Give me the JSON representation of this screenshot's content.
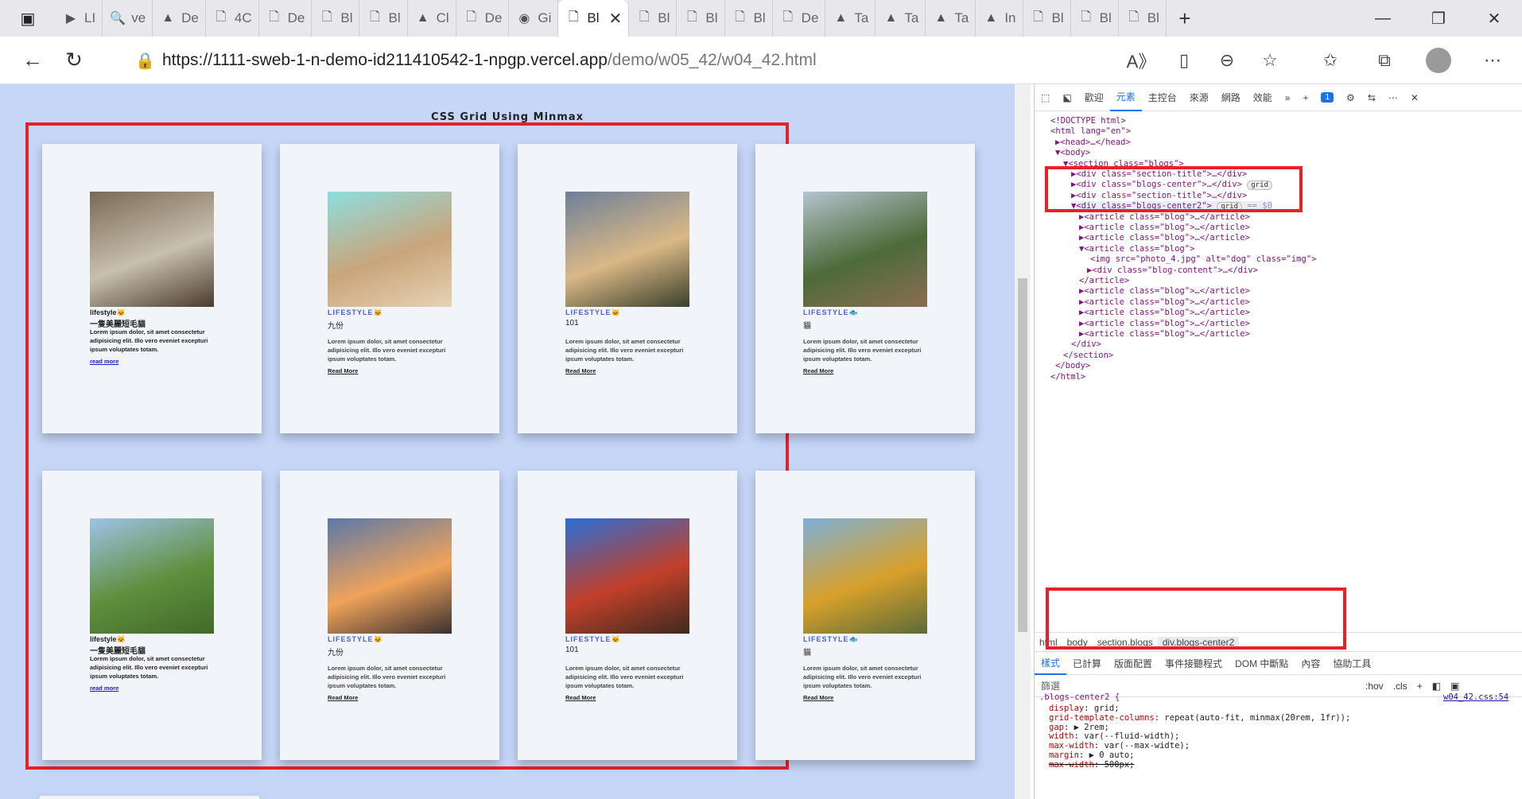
{
  "browser": {
    "tabs": [
      {
        "label": "LI",
        "icon": "play-icon"
      },
      {
        "label": "ve",
        "icon": "search-icon"
      },
      {
        "label": "De",
        "icon": "vercel-icon"
      },
      {
        "label": "4C",
        "icon": "document-icon"
      },
      {
        "label": "De",
        "icon": "document-icon"
      },
      {
        "label": "Bl",
        "icon": "document-icon"
      },
      {
        "label": "Bl",
        "icon": "document-icon"
      },
      {
        "label": "Cl",
        "icon": "vercel-icon"
      },
      {
        "label": "De",
        "icon": "document-icon"
      },
      {
        "label": "Gi",
        "icon": "github-icon"
      },
      {
        "label": "Bl",
        "icon": "document-icon",
        "active": true
      },
      {
        "label": "Bl",
        "icon": "document-icon"
      },
      {
        "label": "Bl",
        "icon": "document-icon"
      },
      {
        "label": "Bl",
        "icon": "document-icon"
      },
      {
        "label": "De",
        "icon": "document-icon"
      },
      {
        "label": "Ta",
        "icon": "vercel-icon"
      },
      {
        "label": "Ta",
        "icon": "vercel-icon"
      },
      {
        "label": "Ta",
        "icon": "vercel-icon"
      },
      {
        "label": "In",
        "icon": "vercel-icon"
      },
      {
        "label": "Bl",
        "icon": "document-icon"
      },
      {
        "label": "Bl",
        "icon": "document-icon"
      },
      {
        "label": "Bl",
        "icon": "document-icon"
      }
    ],
    "url_host": "https://1111-sweb-1-n-demo-id211410542-1-npgp.vercel.app",
    "url_path": "/demo/w05_42/w04_42.html"
  },
  "page": {
    "title": "CSS Grid Using Minmax",
    "blogs": [
      {
        "category": "lifestyle🐱",
        "title": "一隻美麗短毛貓",
        "text": "Lorem ipsum dolor, sit amet consectetur adipisicing elit. Illo vero eveniet excepturi ipsum voluptates totam.",
        "more": "read more",
        "image_colors": [
          "#7a6a55",
          "#c8bfae",
          "#4a3c2e"
        ]
      },
      {
        "category": "LIFESTYLE🐱",
        "title": "九份",
        "text": "Lorem ipsum dolor, sit amet consectetur adipisicing elit. Illo vero eveniet excepturi ipsum voluptates totam.",
        "more": "Read More",
        "image_colors": [
          "#8fdde0",
          "#c9a57a",
          "#e6d2b5"
        ]
      },
      {
        "category": "LIFESTYLE🐱",
        "title": "101",
        "text": "Lorem ipsum dolor, sit amet consectetur adipisicing elit. Illo vero eveniet excepturi ipsum voluptates totam.",
        "more": "Read More",
        "image_colors": [
          "#6e7f99",
          "#d9b886",
          "#3a3f2c"
        ]
      },
      {
        "category": "LIFESTYLE🐟",
        "title": "貓",
        "text": "Lorem ipsum dolor, sit amet consectetur adipisicing elit. Illo vero eveniet excepturi ipsum voluptates totam.",
        "more": "Read More",
        "image_colors": [
          "#b5c3cf",
          "#4d6b3a",
          "#8a6d52"
        ]
      },
      {
        "category": "lifestyle🐱",
        "title": "一隻美麗短毛貓",
        "text": "Lorem ipsum dolor, sit amet consectetur adipisicing elit. Illo vero eveniet excepturi ipsum voluptates totam.",
        "more": "read more",
        "image_colors": [
          "#9ec3e8",
          "#5f8f3c",
          "#3f6a2a"
        ]
      },
      {
        "category": "LIFESTYLE🐱",
        "title": "九份",
        "text": "Lorem ipsum dolor, sit amet consectetur adipisicing elit. Illo vero eveniet excepturi ipsum voluptates totam.",
        "more": "Read More",
        "image_colors": [
          "#5a78a8",
          "#f0a35a",
          "#3a3030"
        ]
      },
      {
        "category": "LIFESTYLE🐱",
        "title": "101",
        "text": "Lorem ipsum dolor, sit amet consectetur adipisicing elit. Illo vero eveniet excepturi ipsum voluptates totam.",
        "more": "Read More",
        "image_colors": [
          "#2a6fd6",
          "#c2402a",
          "#3d2a1e"
        ]
      },
      {
        "category": "LIFESTYLE🐟",
        "title": "貓",
        "text": "Lorem ipsum dolor, sit amet consectetur adipisicing elit. Illo vero eveniet excepturi ipsum voluptates totam.",
        "more": "Read More",
        "image_colors": [
          "#7fb0d8",
          "#d8a02a",
          "#5a6b3a"
        ]
      }
    ]
  },
  "devtools": {
    "tabs": [
      "歡迎",
      "元素",
      "主控台",
      "來源",
      "網路",
      "效能"
    ],
    "active_tab": "元素",
    "badge": "1",
    "dom": [
      "<!DOCTYPE html>",
      "<html lang=\"en\">",
      "▶<head>…</head>",
      "▼<body>",
      "▼<section class=\"blogs\">",
      "▶<div class=\"section-title\">…</div>",
      "▶<div class=\"blogs-center\">…</div>",
      "▶<div class=\"section-title\">…</div>",
      "▼<div class=\"blogs-center2\">",
      "▶<article class=\"blog\">…</article>",
      "▶<article class=\"blog\">…</article>",
      "▶<article class=\"blog\">…</article>",
      "▼<article class=\"blog\">",
      "<img src=\"photo_4.jpg\" alt=\"dog\" class=\"img\">",
      "▶<div class=\"blog-content\">…</div>",
      "</article>",
      "▶<article class=\"blog\">…</article>",
      "▶<article class=\"blog\">…</article>",
      "▶<article class=\"blog\">…</article>",
      "▶<article class=\"blog\">…</article>",
      "▶<article class=\"blog\">…</article>",
      "</div>",
      "</section>",
      "</body>",
      "</html>"
    ],
    "grid_pill": "grid",
    "selected_marker": "== $0",
    "breadcrumbs": [
      "html",
      "body",
      "section.blogs",
      "div.blogs-center2"
    ],
    "style_tabs": [
      "樣式",
      "已計算",
      "版面配置",
      "事件接聽程式",
      "DOM 中斷點",
      "內容",
      "協助工具"
    ],
    "filter_placeholder": "篩選",
    "filter_opts": [
      ":hov",
      ".cls"
    ],
    "css_selector": ".blogs-center2 {",
    "css_source": "w04_42.css:54",
    "css_props": [
      {
        "prop": "display",
        "value": "grid;"
      },
      {
        "prop": "grid-template-columns",
        "value": "repeat(auto-fit, minmax(20rem, 1fr));"
      },
      {
        "prop": "gap",
        "value": "▶ 2rem;"
      },
      {
        "prop": "width",
        "value": "var(--fluid-width);"
      },
      {
        "prop": "max-width",
        "value": "var(--max-widte);"
      },
      {
        "prop": "margin",
        "value": "▶ 0 auto;"
      },
      {
        "prop": "max-width",
        "value": "500px;"
      }
    ]
  },
  "colors": {
    "highlight": "#e8202a",
    "page_bg": "#c5d6f7",
    "card_bg": "#f1f4f9",
    "accent": "#1a73e8"
  }
}
